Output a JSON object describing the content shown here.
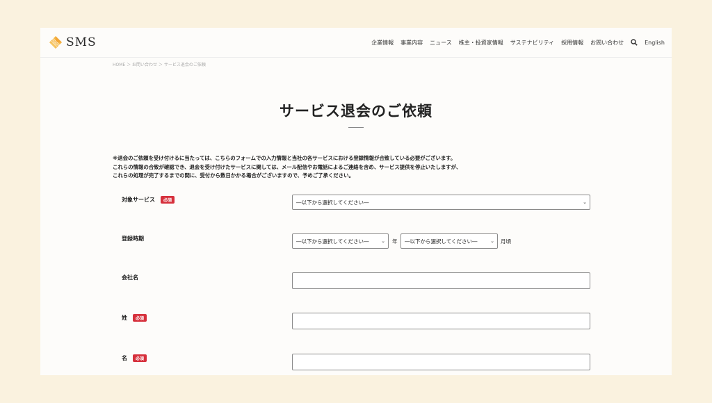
{
  "brand": {
    "name": "SMS"
  },
  "nav": {
    "items": [
      "企業情報",
      "事業内容",
      "ニュース",
      "株主・投資家情報",
      "サステナビリティ",
      "採用情報",
      "お問い合わせ"
    ],
    "language": "English"
  },
  "breadcrumb": "HOME ＞ お問い合わせ ＞ サービス退会のご依頼",
  "page": {
    "title": "サービス退会のご依頼"
  },
  "notice": [
    "※退会のご依頼を受け付けるに当たっては、こちらのフォームでの入力情報と当社の各サービスにおける登録情報が合致している必要がございます。",
    "これらの情報の合致が確認でき、退会を受け付けたサービスに関しては、メール配信やお電話によるご連絡を含め、サービス提供を停止いたしますが、",
    "これらの処理が完了するまでの間に、受付から数日かかる場合がございますので、予めご了承ください。"
  ],
  "form": {
    "required_badge": "必須",
    "service": {
      "label": "対象サービス",
      "value": "―以下から選択してください―"
    },
    "period": {
      "label": "登録時期",
      "year_value": "―以下から選択してください―",
      "year_unit": "年",
      "month_value": "―以下から選択してください―",
      "month_unit": "月頃"
    },
    "company": {
      "label": "会社名",
      "value": ""
    },
    "last_name": {
      "label": "姓",
      "value": ""
    },
    "first_name": {
      "label": "名",
      "value": ""
    }
  },
  "colors": {
    "background": "#faf2df",
    "required": "#d6303c",
    "logo": "#f0a53a"
  },
  "icons": {
    "search": "search-icon",
    "select": "chevron-down-icon"
  }
}
